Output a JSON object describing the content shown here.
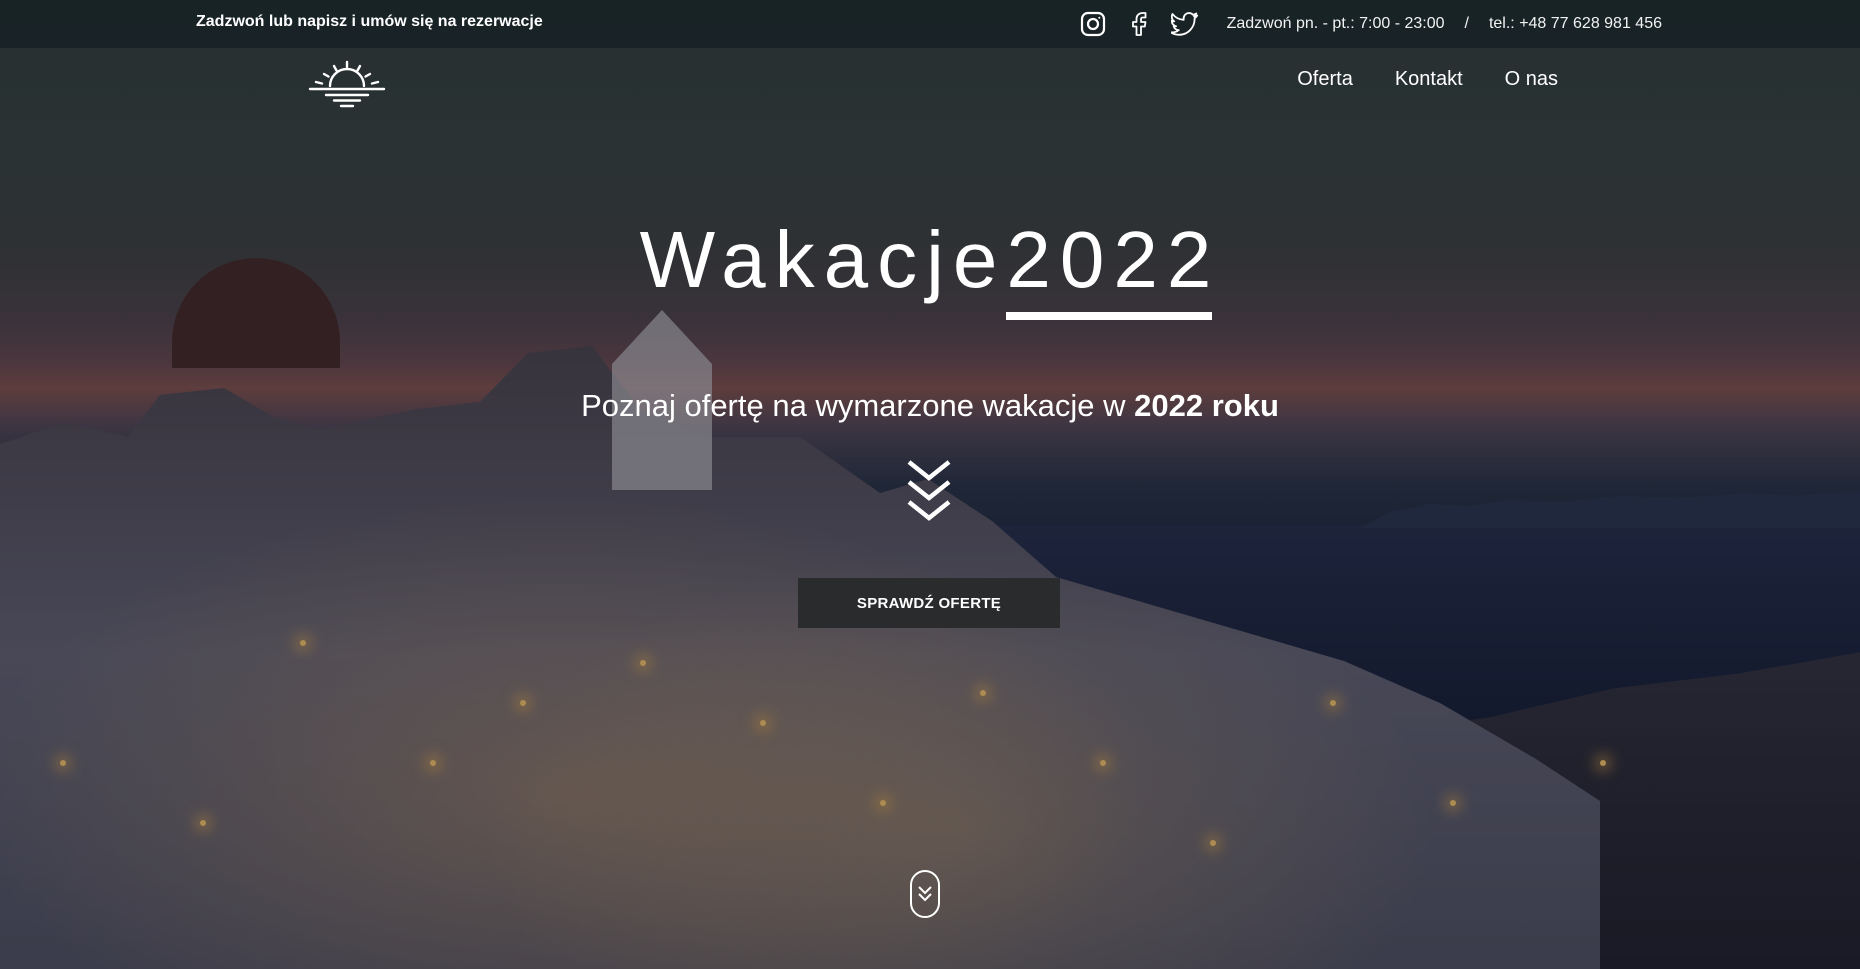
{
  "topbar": {
    "tagline": "Zadzwoń lub napisz i umów się na rezerwacje",
    "social": [
      {
        "icon": "instagram-icon"
      },
      {
        "icon": "facebook-icon"
      },
      {
        "icon": "twitter-icon"
      }
    ],
    "hours": "Zadzwoń pn. - pt.: 7:00 - 23:00",
    "separator": "/",
    "phone": "tel.: +48 77 628 981 456"
  },
  "header": {
    "logo_icon": "sunrise-logo-icon",
    "nav": [
      {
        "label": "Oferta"
      },
      {
        "label": "Kontakt"
      },
      {
        "label": "O nas"
      }
    ]
  },
  "hero": {
    "title_main": "Wakacje",
    "title_year": "2022",
    "subtitle_prefix": "Poznaj ofertę na wymarzone wakacje w ",
    "subtitle_bold": "2022 roku",
    "chevron_icon": "triple-chevron-down-icon",
    "cta_label": "SPRAWDŹ OFERTĘ",
    "scroll_icon": "scroll-down-icon"
  },
  "colors": {
    "topbar_bg": "#141e22",
    "cta_bg": "#2a2b2d",
    "text": "#ffffff"
  }
}
